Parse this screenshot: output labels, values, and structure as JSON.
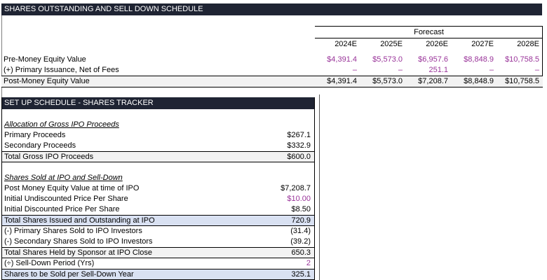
{
  "colors": {
    "header_bg": "#1F2433",
    "input_purple": "#993399",
    "total_gray": "#F2F2F2",
    "total_blue": "#D9E1F2"
  },
  "title_bar": "SHARES OUTSTANDING AND SELL DOWN SCHEDULE",
  "top_table": {
    "forecast_label": "Forecast",
    "years": [
      "2024E",
      "2025E",
      "2026E",
      "2027E",
      "2028E"
    ],
    "rows": [
      {
        "label": "Pre-Money Equity Value",
        "values": [
          "$4,391.4",
          "$5,573.0",
          "$6,957.6",
          "$8,848.9",
          "$10,758.5"
        ]
      },
      {
        "label": "(+) Primary Issuance, Net of Fees",
        "values": [
          "–",
          "–",
          "251.1",
          "–",
          "–"
        ]
      },
      {
        "label": "Post-Money Equity Value",
        "values": [
          "$4,391.4",
          "$5,573.0",
          "$7,208.7",
          "$8,848.9",
          "$10,758.5"
        ]
      }
    ]
  },
  "tracker": {
    "header": "SET UP SCHEDULE - SHARES TRACKER",
    "heading1": "Allocation of Gross IPO Proceeds",
    "heading2": "Shares Sold at IPO and Sell-Down",
    "rows": [
      {
        "label": "Primary Proceeds",
        "value": "$267.1"
      },
      {
        "label": "Secondary Proceeds",
        "value": "$332.9"
      },
      {
        "label": "Total Gross IPO Proceeds",
        "value": "$600.0"
      },
      {
        "label": "Post Money Equity Value at time of IPO",
        "value": "$7,208.7"
      },
      {
        "label": "Initial Undiscounted Price Per Share",
        "value": "$10.00"
      },
      {
        "label": "Initial Discounted Price Per Share",
        "value": "$8.50"
      },
      {
        "label": "Total Shares Issued and Outstanding at IPO",
        "value": "720.9"
      },
      {
        "label": "(-) Primary Shares Sold to IPO Investors",
        "value": "(31.4)"
      },
      {
        "label": "(-) Secondary Shares Sold to IPO Investors",
        "value": "(39.2)"
      },
      {
        "label": "Total Shares Held by Sponsor at IPO Close",
        "value": "650.3"
      },
      {
        "label": "(÷) Sell-Down Period (Yrs)",
        "value": "2"
      },
      {
        "label": "Shares to be Sold per Sell-Down Year",
        "value": "325.1"
      }
    ]
  }
}
